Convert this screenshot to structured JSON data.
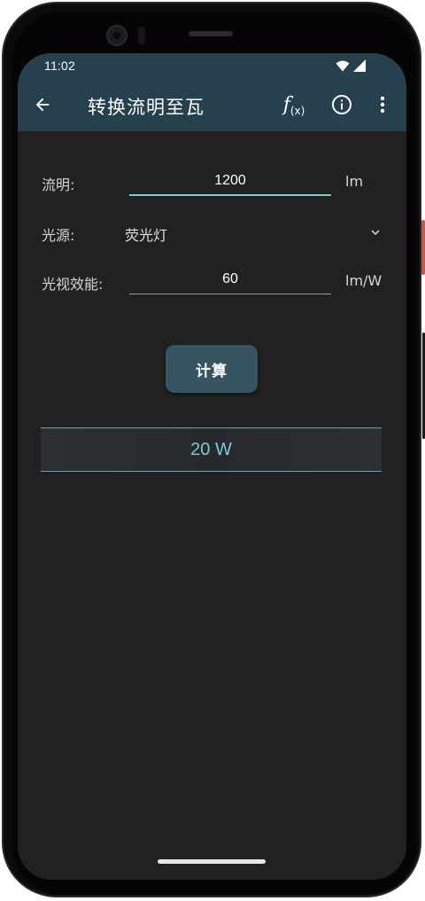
{
  "status": {
    "time": "11:02",
    "icons": [
      "wifi-icon",
      "cell-signal-icon"
    ]
  },
  "appbar": {
    "title": "转换流明至瓦",
    "back_icon": "arrow-left-icon",
    "actions": [
      "function-fx-icon",
      "info-icon",
      "more-vert-icon"
    ],
    "fx_f": "f",
    "fx_x": "(x)"
  },
  "form": {
    "lumen": {
      "label": "流明:",
      "value": "1200",
      "unit": "lm"
    },
    "light_source": {
      "label": "光源:",
      "selected": "荧光灯"
    },
    "efficacy": {
      "label": "光视效能:",
      "value": "60",
      "unit": "lm/W"
    }
  },
  "calculate_label": "计算",
  "result": "20 W",
  "colors": {
    "appbar": "#27404d",
    "background": "#212121",
    "accent": "#7ec8d4",
    "button": "#375461"
  }
}
